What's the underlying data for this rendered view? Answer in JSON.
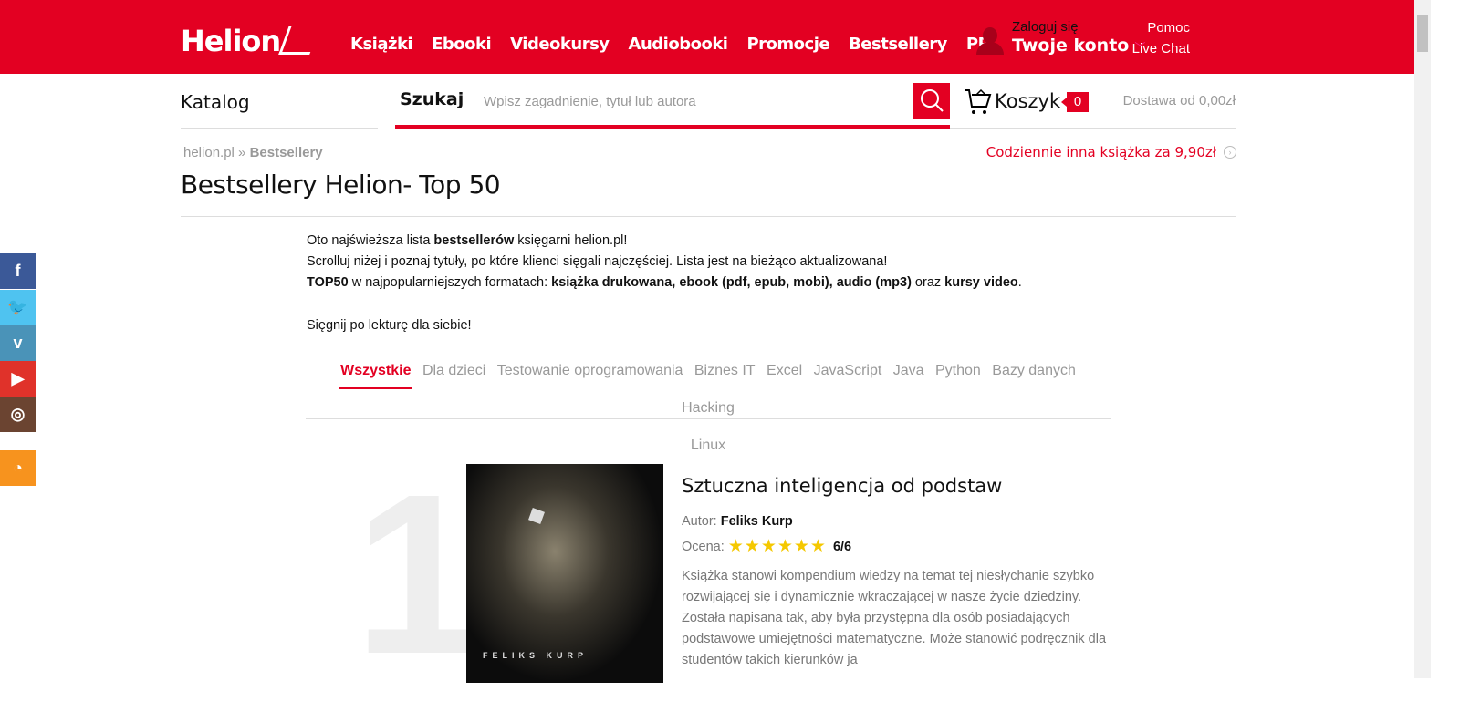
{
  "brand": {
    "logo": "Helion",
    "accent": "#e30022"
  },
  "nav": [
    "Książki",
    "Ebooki",
    "Videokursy",
    "Audiobooki",
    "Promocje",
    "Bestsellery",
    "PP"
  ],
  "account": {
    "login": "Zaloguj się",
    "label": "Twoje konto"
  },
  "help": {
    "pomoc": "Pomoc",
    "chat": "Live Chat"
  },
  "catalog": "Katalog",
  "search": {
    "label": "Szukaj",
    "placeholder": "Wpisz zagadnienie, tytuł lub autora"
  },
  "cart": {
    "label": "Koszyk",
    "count": "0",
    "delivery": "Dostawa od 0,00zł"
  },
  "breadcrumb": {
    "home": "helion.pl",
    "sep": " » ",
    "current": "Bestsellery"
  },
  "daily": "Codziennie inna książka za 9,90zł",
  "page_title": "Bestsellery Helion- Top 50",
  "intro": {
    "l1a": "Oto najświeższa lista ",
    "l1b": "bestsellerów",
    "l1c": " księgarni helion.pl!",
    "l2": "Scrolluj niżej i poznaj tytuły, po które klienci sięgali najczęściej. Lista jest na bieżąco aktualizowana!",
    "l3a": "TOP50",
    "l3b": " w najpopularniejszych formatach: ",
    "l3c": "książka drukowana, ebook (pdf, epub, mobi), audio (mp3)",
    "l3d": " oraz ",
    "l3e": "kursy video",
    "l3f": ".",
    "l4": "Sięgnij po lekturę dla siebie!"
  },
  "tabs": [
    "Wszystkie",
    "Dla dzieci",
    "Testowanie oprogramowania",
    "Biznes IT",
    "Excel",
    "JavaScript",
    "Java",
    "Python",
    "Bazy danych",
    "Hacking",
    "Linux"
  ],
  "book": {
    "rank": "1",
    "title": "Sztuczna inteligencja od podstaw",
    "author_label": "Autor:",
    "author": "Feliks Kurp",
    "rating_label": "Ocena:",
    "rating": "6/6",
    "stars": 6,
    "cover_author": "FELIKS KURP",
    "description": "Książka stanowi kompendium wiedzy na temat tej niesłychanie szybko rozwijającej się i dynamicznie wkraczającej w nasze życie dziedziny. Została napisana tak, aby była przystępna dla osób posiadających podstawowe umiejętności matematyczne. Może stanowić podręcznik dla studentów takich kierunków ja"
  },
  "social": [
    {
      "icon": "facebook-icon",
      "glyph": "f",
      "color": "#3b5998"
    },
    {
      "icon": "twitter-icon",
      "glyph": "🐦",
      "color": "#4fc3f0"
    },
    {
      "icon": "vimeo-icon",
      "glyph": "v",
      "color": "#4a93b8"
    },
    {
      "icon": "youtube-icon",
      "glyph": "▶",
      "color": "#e0322a"
    },
    {
      "icon": "instagram-icon",
      "glyph": "◎",
      "color": "#6b4431"
    },
    {
      "icon": "rss-icon",
      "glyph": "◔",
      "color": "#f7931e"
    }
  ]
}
